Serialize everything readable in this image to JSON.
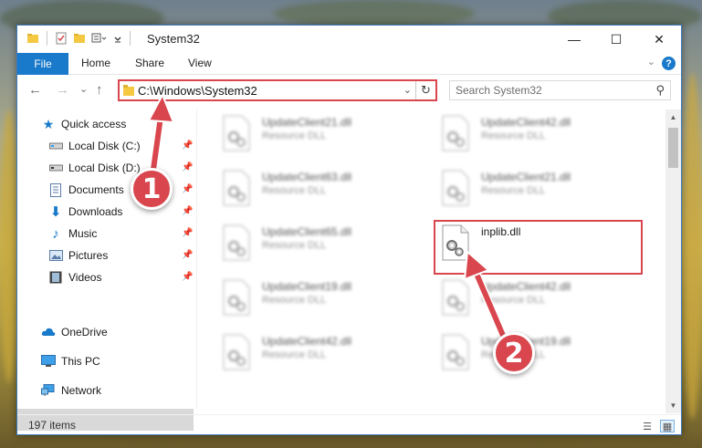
{
  "window": {
    "title": "System32",
    "controls": {
      "minimize": "—",
      "maximize": "☐",
      "close": "✕"
    }
  },
  "ribbon": {
    "tabs": [
      "File",
      "Home",
      "Share",
      "View"
    ],
    "help": "?"
  },
  "navigation": {
    "back": "←",
    "forward": "→",
    "recent": "⌄",
    "up": "↑",
    "address": "C:\\Windows\\System32",
    "search_placeholder": "Search System32"
  },
  "sidebar": {
    "items": [
      {
        "label": "Quick access",
        "icon": "star-icon",
        "pinned": false
      },
      {
        "label": "Local Disk (C:)",
        "icon": "drive-icon",
        "pinned": true
      },
      {
        "label": "Local Disk (D:)",
        "icon": "drive-icon",
        "pinned": true
      },
      {
        "label": "Documents",
        "icon": "document-icon",
        "pinned": true
      },
      {
        "label": "Downloads",
        "icon": "download-icon",
        "pinned": true
      },
      {
        "label": "Music",
        "icon": "music-icon",
        "pinned": true
      },
      {
        "label": "Pictures",
        "icon": "pictures-icon",
        "pinned": true
      },
      {
        "label": "Videos",
        "icon": "video-icon",
        "pinned": true
      },
      {
        "label": "OneDrive",
        "icon": "cloud-icon",
        "pinned": false
      },
      {
        "label": "This PC",
        "icon": "computer-icon",
        "pinned": false,
        "selected": true
      },
      {
        "label": "Network",
        "icon": "network-icon",
        "pinned": false
      }
    ]
  },
  "files": [
    {
      "name": "UpdateClient21.dll",
      "type": "Resource DLL",
      "blurred": true
    },
    {
      "name": "UpdateClient42.dll",
      "type": "Resource DLL",
      "blurred": true
    },
    {
      "name": "UpdateClient63.dll",
      "type": "Resource DLL",
      "blurred": true
    },
    {
      "name": "UpdateClient21.dll",
      "type": "Resource DLL",
      "blurred": true
    },
    {
      "name": "UpdateClient65.dll",
      "type": "Resource DLL",
      "blurred": true
    },
    {
      "name": "inplib.dll",
      "type": "",
      "blurred": false,
      "highlighted": true
    },
    {
      "name": "UpdateClient19.dll",
      "type": "Resource DLL",
      "blurred": true
    },
    {
      "name": "UpdateClient42.dll",
      "type": "Resource DLL",
      "blurred": true
    },
    {
      "name": "UpdateClient42.dll",
      "type": "Resource DLL",
      "blurred": true
    },
    {
      "name": "UpdateClient19.dll",
      "type": "Resource DLL",
      "blurred": true
    }
  ],
  "status": {
    "item_count": "197 items"
  },
  "callouts": {
    "step1": "1",
    "step2": "2"
  },
  "colors": {
    "accent": "#1979ca",
    "highlight": "#d9464d"
  }
}
